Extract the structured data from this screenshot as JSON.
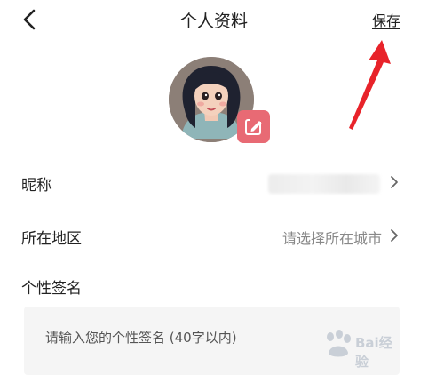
{
  "header": {
    "title": "个人资料",
    "save_label": "保存",
    "back_icon": "chevron-left-icon"
  },
  "avatar": {
    "edit_icon": "edit-icon",
    "badge_color": "#e86a74"
  },
  "fields": {
    "nickname": {
      "label": "昵称",
      "value_hidden": true
    },
    "region": {
      "label": "所在地区",
      "value": "请选择所在城市"
    }
  },
  "signature": {
    "label": "个性签名",
    "placeholder": "请输入您的个性签名 (40字以内)"
  },
  "annotation": {
    "color": "#e8232a"
  },
  "watermark": {
    "text": "Bai经验"
  }
}
